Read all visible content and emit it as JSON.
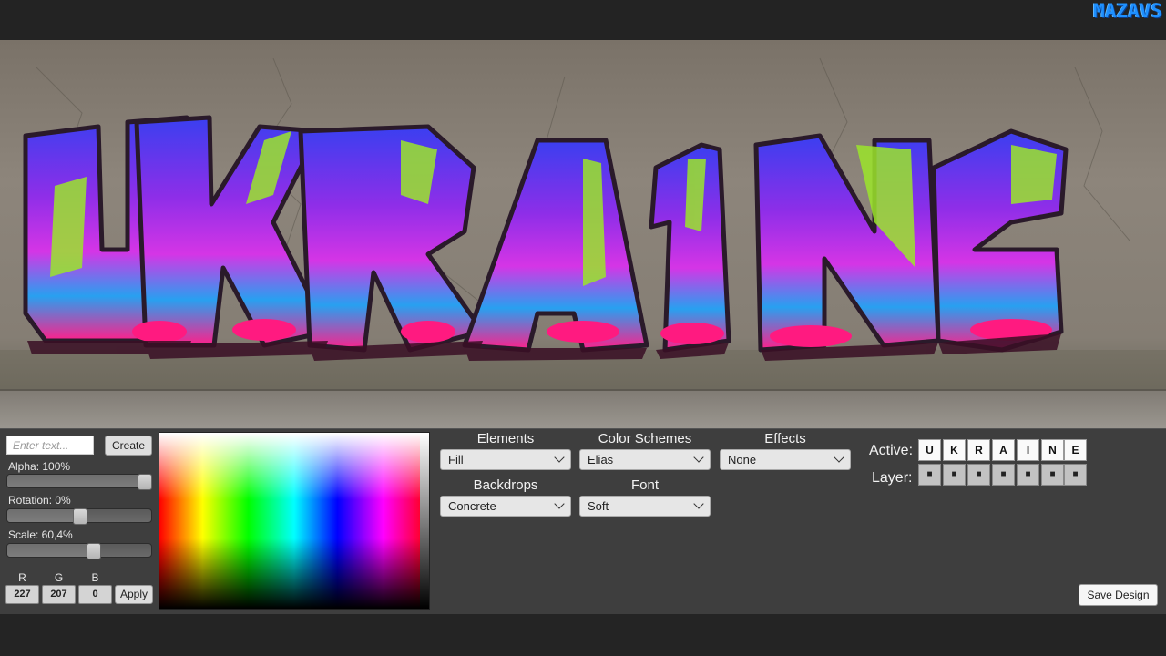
{
  "app": {
    "logo": "MAZAVS"
  },
  "canvas": {
    "graffiti_text": "UKRAINE",
    "backdrop": "concrete-wall"
  },
  "input": {
    "placeholder": "Enter text...",
    "value": ""
  },
  "buttons": {
    "create": "Create",
    "apply": "Apply",
    "save": "Save Design"
  },
  "sliders": {
    "alpha": {
      "label": "Alpha: 100%",
      "value": 1.0
    },
    "rotation": {
      "label": "Rotation: 0%",
      "value": 0.5
    },
    "scale": {
      "label": "Scale: 60,4%",
      "value": 0.6
    }
  },
  "rgb": {
    "labels": [
      "R",
      "G",
      "B"
    ],
    "values": [
      "227",
      "207",
      "0"
    ]
  },
  "dropdowns": {
    "elements": {
      "header": "Elements",
      "selected": "Fill"
    },
    "color_schemes": {
      "header": "Color Schemes",
      "selected": "Elias"
    },
    "effects": {
      "header": "Effects",
      "selected": "None"
    },
    "backdrops": {
      "header": "Backdrops",
      "selected": "Concrete"
    },
    "font": {
      "header": "Font",
      "selected": "Soft"
    }
  },
  "active": {
    "label": "Active:",
    "letters": [
      "U",
      "K",
      "R",
      "A",
      "I",
      "N",
      "E"
    ]
  },
  "layer": {
    "label": "Layer:",
    "marks": [
      "■",
      "■",
      "■",
      "■",
      "■",
      "■",
      "■"
    ]
  },
  "colors": {
    "logo": "#1e90ff",
    "panel": "#3e3e3e"
  },
  "icons": [
    "chevron-down-icon"
  ]
}
